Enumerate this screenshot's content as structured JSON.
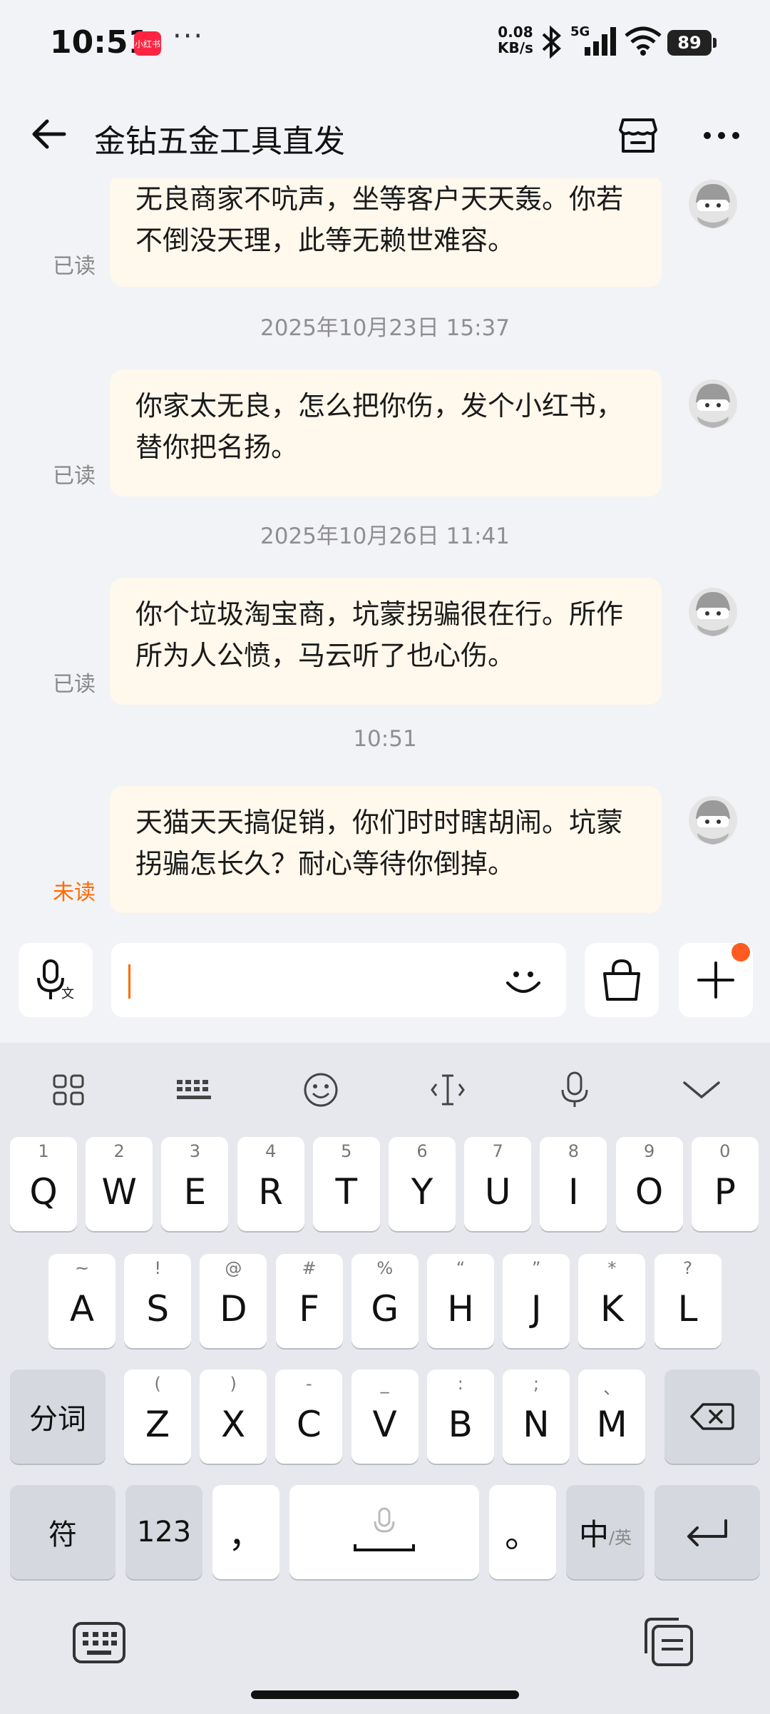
{
  "status_bar": {
    "time": "10:51",
    "app_badge": "小红书",
    "dots": "···",
    "net_speed_value": "0.08",
    "net_speed_unit": "KB/s",
    "network": "5G",
    "battery": "89"
  },
  "header": {
    "title": "金钻五金工具直发"
  },
  "messages": [
    {
      "text": "无良商家不吭声，坐等客户天天轰。你若不倒没天理，此等无赖世难容。",
      "status": "已读"
    },
    {
      "timestamp": "2025年10月23日 15:37"
    },
    {
      "text": "你家太无良，怎么把你伤，发个小红书，替你把名扬。",
      "status": "已读"
    },
    {
      "timestamp": "2025年10月26日 11:41"
    },
    {
      "text": "你个垃圾淘宝商，坑蒙拐骗很在行。所作所为人公愤，马云听了也心伤。",
      "status": "已读"
    },
    {
      "timestamp": "10:51"
    },
    {
      "text": "天猫天天搞促销，你们时时瞎胡闹。坑蒙拐骗怎长久？耐心等待你倒掉。",
      "status": "未读"
    }
  ],
  "input": {
    "value": "",
    "voice_icon_label": "文"
  },
  "keyboard": {
    "row1": [
      [
        "1",
        "Q"
      ],
      [
        "2",
        "W"
      ],
      [
        "3",
        "E"
      ],
      [
        "4",
        "R"
      ],
      [
        "5",
        "T"
      ],
      [
        "6",
        "Y"
      ],
      [
        "7",
        "U"
      ],
      [
        "8",
        "I"
      ],
      [
        "9",
        "O"
      ],
      [
        "0",
        "P"
      ]
    ],
    "row2": [
      [
        "~",
        "A"
      ],
      [
        "!",
        "S"
      ],
      [
        "@",
        "D"
      ],
      [
        "#",
        "F"
      ],
      [
        "%",
        "G"
      ],
      [
        "“",
        "H"
      ],
      [
        "”",
        "J"
      ],
      [
        "*",
        "K"
      ],
      [
        "?",
        "L"
      ]
    ],
    "row3": [
      [
        "(",
        "Z"
      ],
      [
        ")",
        "X"
      ],
      [
        "-",
        "C"
      ],
      [
        "_",
        "V"
      ],
      [
        ":",
        "B"
      ],
      [
        ";",
        "N"
      ],
      [
        "、",
        "M"
      ]
    ],
    "fenci": "分词",
    "fu": "符",
    "num": "123",
    "comma": "，",
    "period": "。",
    "lang_main": "中",
    "lang_sub": "/英"
  }
}
